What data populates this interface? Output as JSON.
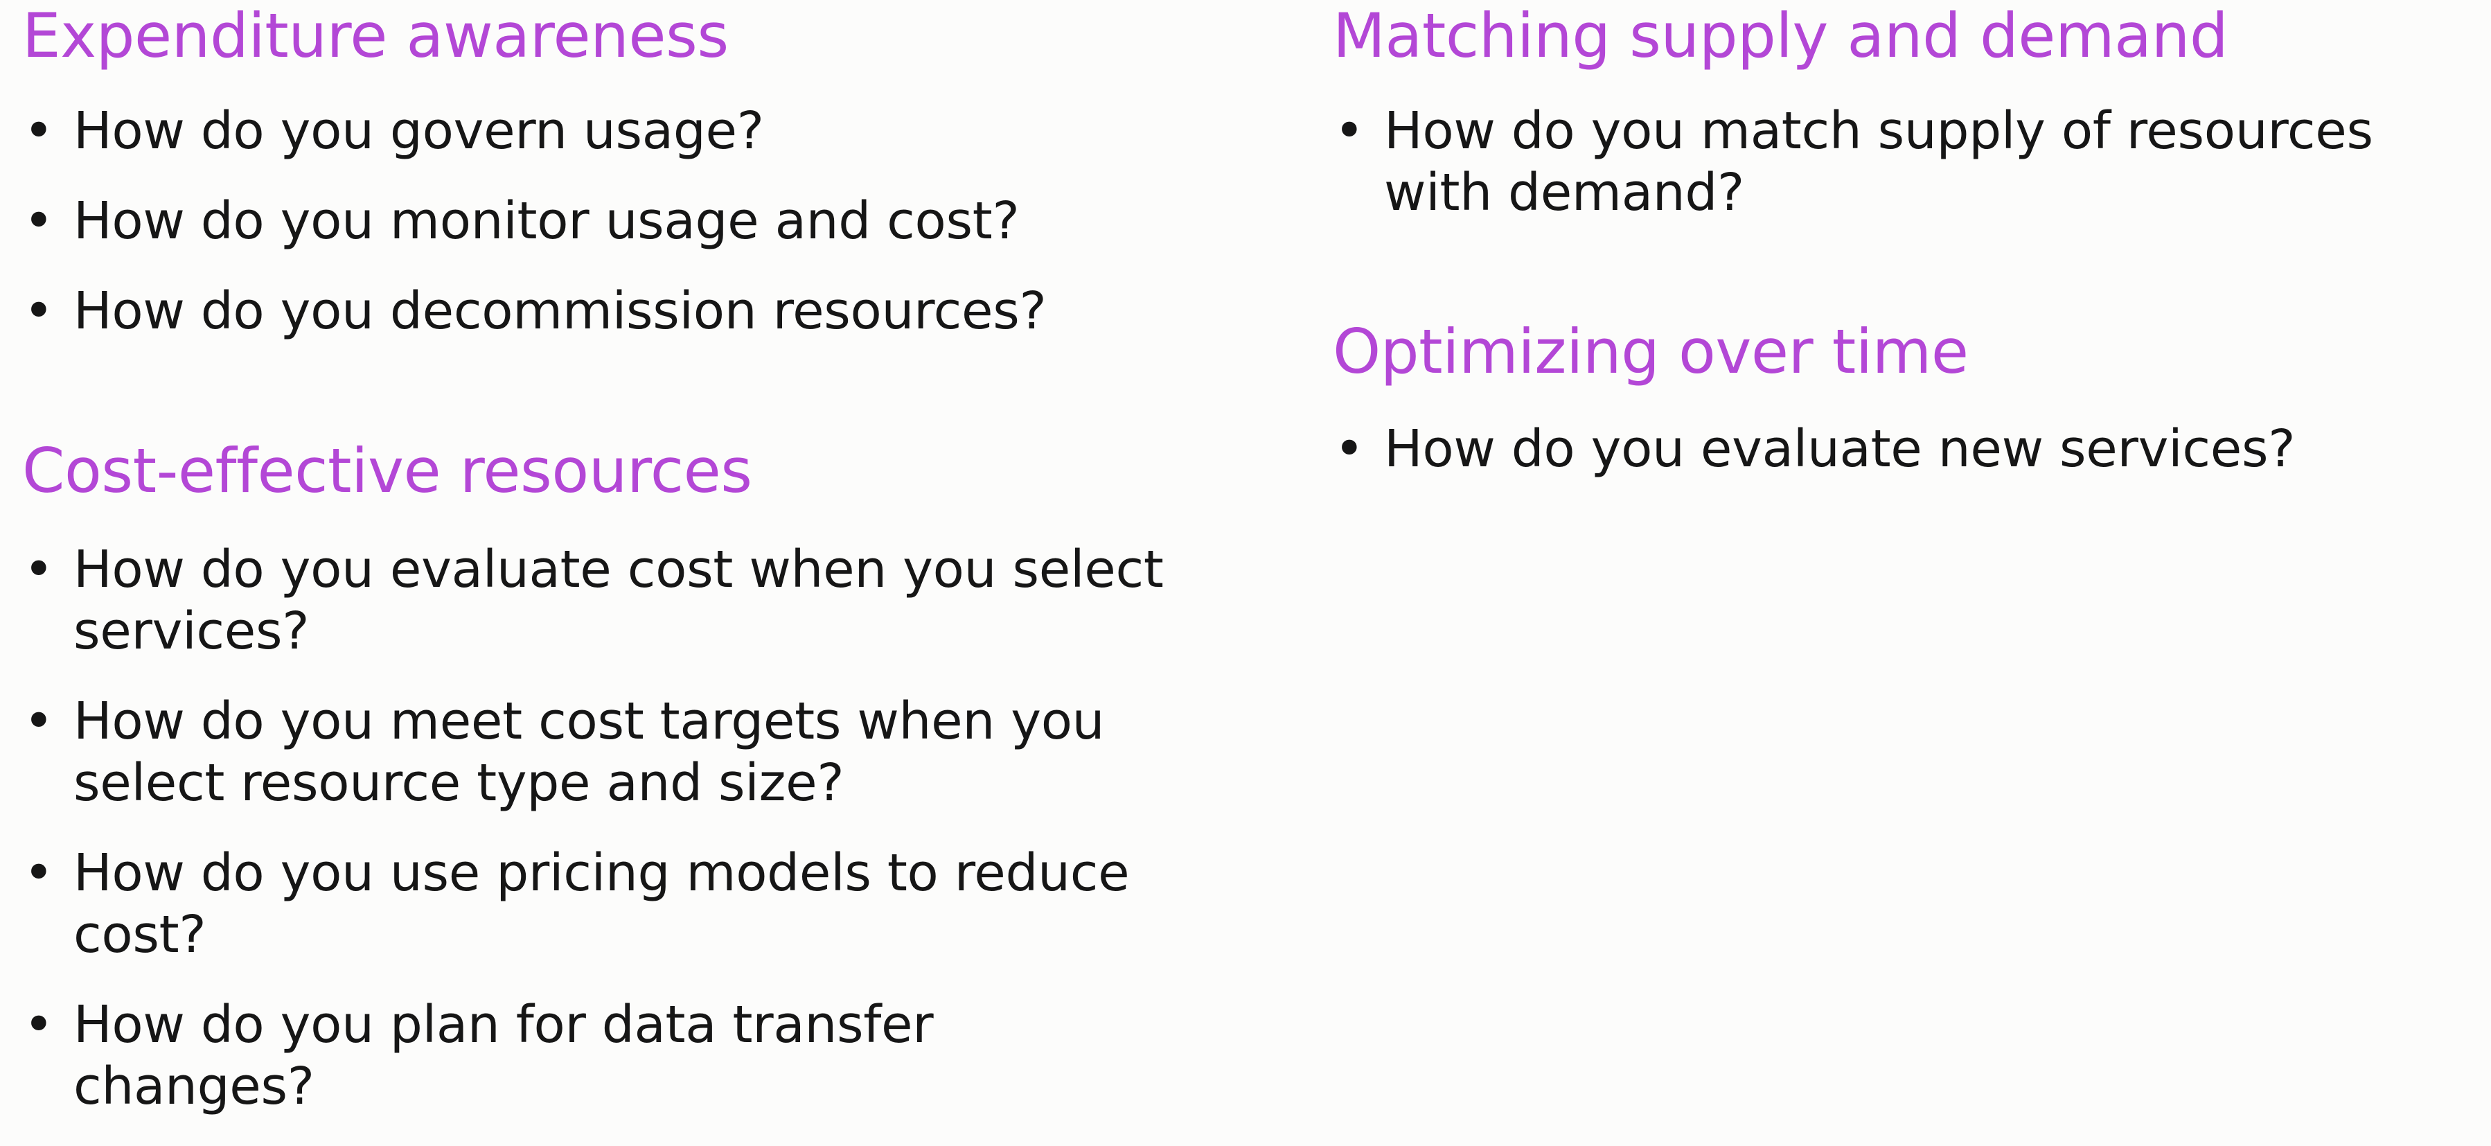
{
  "left_column": {
    "sections": [
      {
        "title": "Expenditure awareness",
        "bullets": [
          "How do you govern usage?",
          "How do you monitor usage and cost?",
          "How do you decommission resources?"
        ]
      },
      {
        "title": "Cost-effective resources",
        "bullets": [
          "How do you evaluate cost when you select services?",
          "How do you meet cost targets when you select resource type and size?",
          "How do you use pricing models to reduce cost?",
          "How do you plan for data transfer changes?"
        ]
      }
    ]
  },
  "right_column": {
    "sections": [
      {
        "title": "Matching supply and demand",
        "bullets": [
          "How do you match supply of resources with demand?"
        ]
      },
      {
        "title": "Optimizing over time",
        "bullets": [
          "How do you evaluate new services?"
        ]
      }
    ]
  },
  "bullet_glyph": "•",
  "colors": {
    "heading": "#b347d6",
    "text": "#161616",
    "background": "#fcfcfb"
  }
}
